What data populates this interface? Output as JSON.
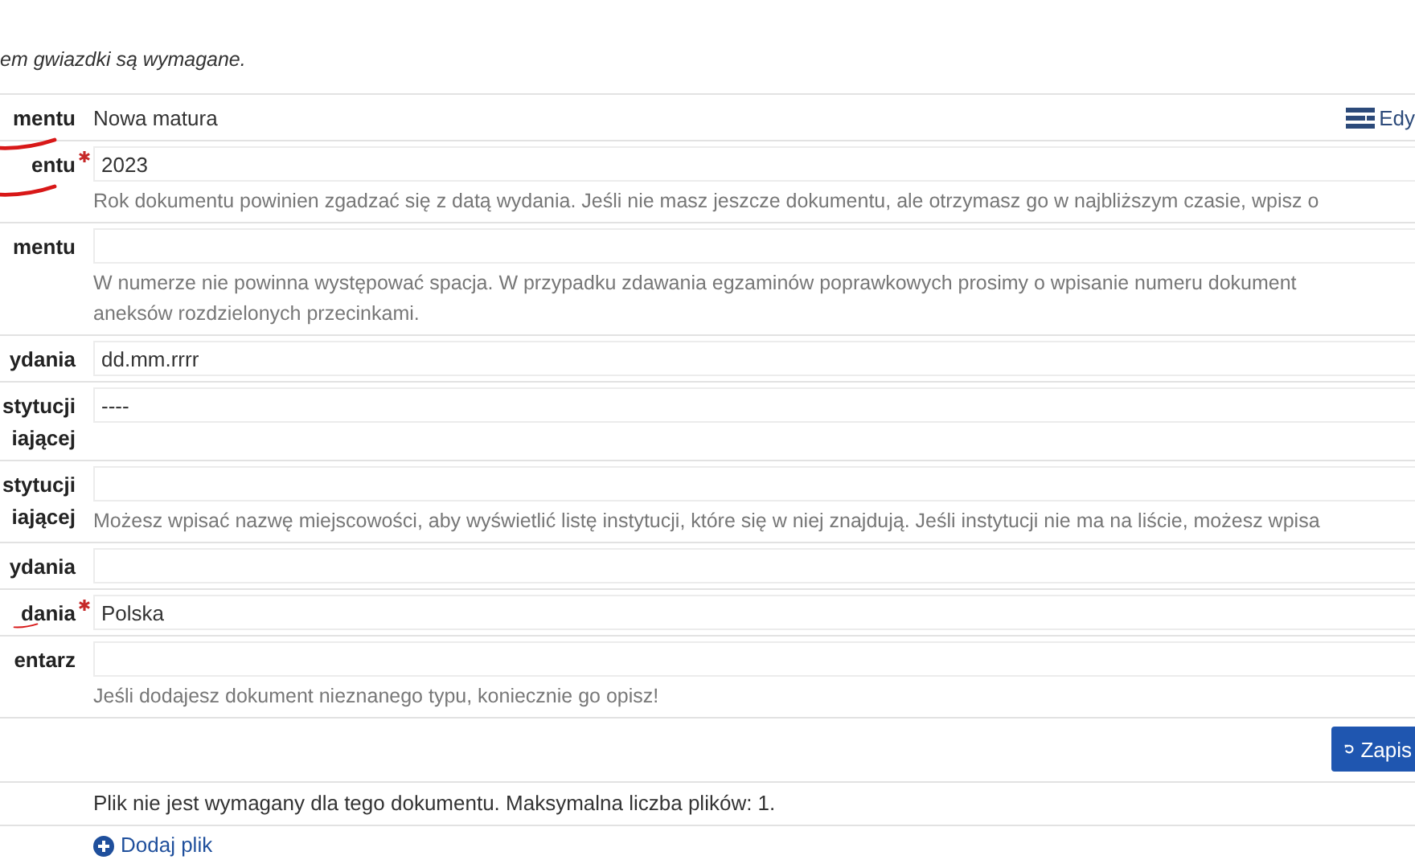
{
  "intro": "em gwiazdki są wymagane.",
  "rows": [
    {
      "label_lines": [
        "mentu"
      ],
      "required": false,
      "marked": true,
      "kind": "static",
      "value": "Nowa matura",
      "action": "Edy"
    },
    {
      "label_lines": [
        "entu"
      ],
      "required": true,
      "marked": true,
      "kind": "input",
      "value": "2023",
      "hint": "Rok dokumentu powinien zgadzać się z datą wydania. Jeśli nie masz jeszcze dokumentu, ale otrzymasz go w najbliższym czasie, wpisz o"
    },
    {
      "label_lines": [
        "mentu"
      ],
      "required": false,
      "marked": false,
      "kind": "input",
      "value": "",
      "hint": "W numerze nie powinna występować spacja. W przypadku zdawania egzaminów poprawkowych prosimy o wpisanie numeru dokument\naneksów rozdzielonych przecinkami."
    },
    {
      "label_lines": [
        "ydania"
      ],
      "required": false,
      "marked": false,
      "kind": "input",
      "value": "dd.mm.rrrr"
    },
    {
      "label_lines": [
        "stytucji",
        "iającej"
      ],
      "required": false,
      "marked": false,
      "kind": "select",
      "value": "----"
    },
    {
      "label_lines": [
        "stytucji",
        "iającej"
      ],
      "required": false,
      "marked": false,
      "kind": "input",
      "value": "",
      "hint": "Możesz wpisać nazwę miejscowości, aby wyświetlić listę instytucji, które się w niej znajdują. Jeśli instytucji nie ma na liście, możesz wpisa"
    },
    {
      "label_lines": [
        "ydania"
      ],
      "required": false,
      "marked": false,
      "kind": "input",
      "value": ""
    },
    {
      "label_lines": [
        "dania"
      ],
      "required": true,
      "marked": true,
      "kind": "input",
      "value": "Polska"
    },
    {
      "label_lines": [
        "entarz"
      ],
      "required": false,
      "marked": false,
      "kind": "input",
      "value": "",
      "hint": "Jeśli dodajesz dokument nieznanego typu, koniecznie go opisz!"
    }
  ],
  "save_button": "Zapis",
  "file_note": "Plik nie jest wymagany dla tego dokumentu. Maksymalna liczba plików: 1.",
  "add_file": "Dodaj plik"
}
